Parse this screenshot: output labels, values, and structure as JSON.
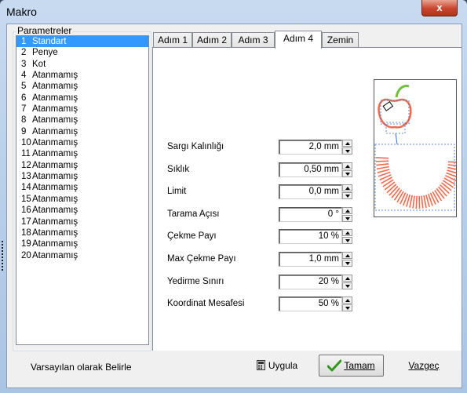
{
  "window": {
    "title": "Makro",
    "close_glyph": "x"
  },
  "params": {
    "group_label": "Parametreler",
    "items": [
      {
        "num": "1",
        "label": "Standart",
        "selected": true
      },
      {
        "num": "2",
        "label": "Penye"
      },
      {
        "num": "3",
        "label": "Kot"
      },
      {
        "num": "4",
        "label": "Atanmamış"
      },
      {
        "num": "5",
        "label": "Atanmamış"
      },
      {
        "num": "6",
        "label": "Atanmamış"
      },
      {
        "num": "7",
        "label": "Atanmamış"
      },
      {
        "num": "8",
        "label": "Atanmamış"
      },
      {
        "num": "9",
        "label": "Atanmamış"
      },
      {
        "num": "10",
        "label": "Atanmamış"
      },
      {
        "num": "11",
        "label": "Atanmamış"
      },
      {
        "num": "12",
        "label": "Atanmamış"
      },
      {
        "num": "13",
        "label": "Atanmamış"
      },
      {
        "num": "14",
        "label": "Atanmamış"
      },
      {
        "num": "15",
        "label": "Atanmamış"
      },
      {
        "num": "16",
        "label": "Atanmamış"
      },
      {
        "num": "17",
        "label": "Atanmamış"
      },
      {
        "num": "18",
        "label": "Atanmamış"
      },
      {
        "num": "19",
        "label": "Atanmamış"
      },
      {
        "num": "20",
        "label": "Atanmamış"
      }
    ]
  },
  "tabs": [
    "Adım 1",
    "Adım 2",
    "Adım 3",
    "Adım 4",
    "Zemin"
  ],
  "active_tab": "Adım 4",
  "fields": [
    {
      "label": "Sargı Kalınlığı",
      "value": "2,0 mm"
    },
    {
      "label": "Sıklık",
      "value": "0,50 mm"
    },
    {
      "label": "Limit",
      "value": "0,0 mm"
    },
    {
      "label": "Tarama Açısı",
      "value": "0 °"
    },
    {
      "label": "Çekme Payı",
      "value": "10 %"
    },
    {
      "label": "Max Çekme Payı",
      "value": "1,0 mm"
    },
    {
      "label": "Yedirme Sınırı",
      "value": "20 %"
    },
    {
      "label": "Koordinat Mesafesi",
      "value": "50 %"
    }
  ],
  "footer": {
    "default_label": "Varsayılan olarak Belirle",
    "apply_label": "Uygula",
    "ok_label": "Tamam",
    "cancel_label": "Vazgeç"
  },
  "icons": {
    "apply": "calculator-icon",
    "ok": "checkmark-icon",
    "preview": "apple-embroidery-preview"
  },
  "colors": {
    "selection": "#3399ff",
    "stitch": "#f06a4e",
    "leaf": "#6fbf3a"
  }
}
